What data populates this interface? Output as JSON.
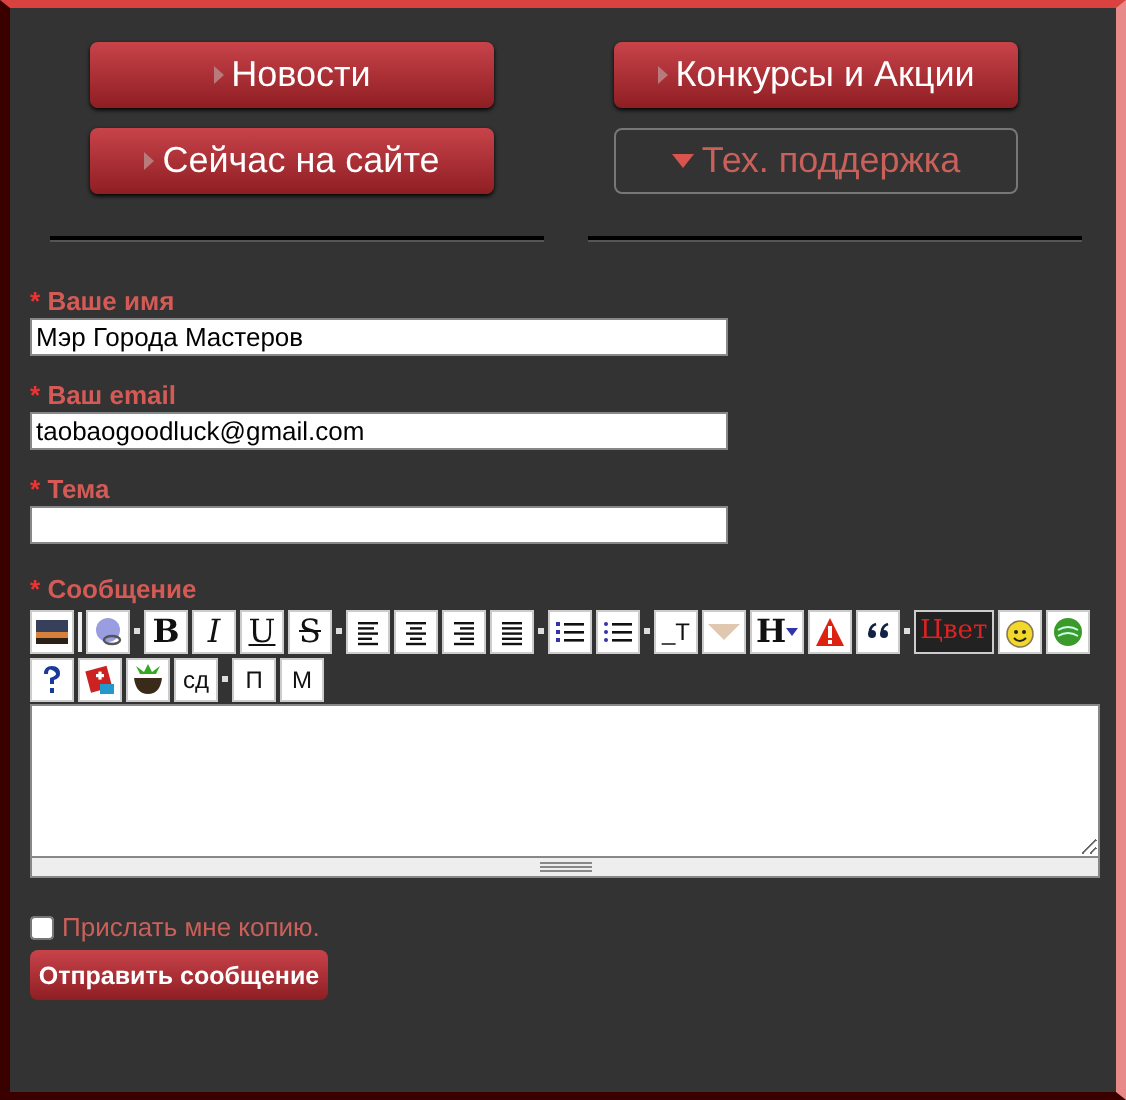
{
  "nav": [
    {
      "label": "Новости",
      "active": false
    },
    {
      "label": "Конкурсы и Акции",
      "active": false
    },
    {
      "label": "Сейчас на сайте",
      "active": false
    },
    {
      "label": "Тех. поддержка",
      "active": true
    }
  ],
  "fields": [
    {
      "mark": "*",
      "label": "Ваше имя",
      "value": "Мэр Города Мастеров"
    },
    {
      "mark": "*",
      "label": "Ваш email",
      "value": "taobaogoodluck@gmail.com"
    },
    {
      "mark": "*",
      "label": "Тема"
    }
  ],
  "message": {
    "mark": "*",
    "label": "Сообщение"
  },
  "toolbar": [
    [
      {
        "kind": "picture"
      },
      {
        "kind": "bar"
      },
      {
        "kind": "link"
      },
      {
        "kind": "sep"
      },
      {
        "kind": "bold",
        "label": "B"
      },
      {
        "kind": "italic",
        "label": "I"
      },
      {
        "kind": "underline",
        "label": "U"
      },
      {
        "kind": "strike",
        "label": "S"
      },
      {
        "kind": "sep"
      },
      {
        "kind": "align-left"
      },
      {
        "kind": "align-center"
      },
      {
        "kind": "align-right"
      },
      {
        "kind": "justify"
      },
      {
        "kind": "sep"
      },
      {
        "kind": "numbered-list"
      },
      {
        "kind": "bullet-list"
      },
      {
        "kind": "sep"
      },
      {
        "kind": "plain",
        "label": "_T"
      },
      {
        "kind": "triangle"
      },
      {
        "kind": "heading",
        "label": "H"
      },
      {
        "kind": "warning"
      },
      {
        "kind": "quote"
      },
      {
        "kind": "sep"
      },
      {
        "kind": "color",
        "label": "Цвет"
      },
      {
        "kind": "smiley"
      },
      {
        "kind": "ball"
      }
    ],
    [
      {
        "kind": "question"
      },
      {
        "kind": "gift"
      },
      {
        "kind": "bowl"
      },
      {
        "kind": "plain",
        "label": "сд"
      },
      {
        "kind": "sep"
      },
      {
        "kind": "plain",
        "label": "П"
      },
      {
        "kind": "plain",
        "label": "М"
      }
    ]
  ],
  "copy": {
    "label": "Прислать мне копию.",
    "checked": false
  },
  "submit": {
    "label": "Отправить сообщение"
  }
}
